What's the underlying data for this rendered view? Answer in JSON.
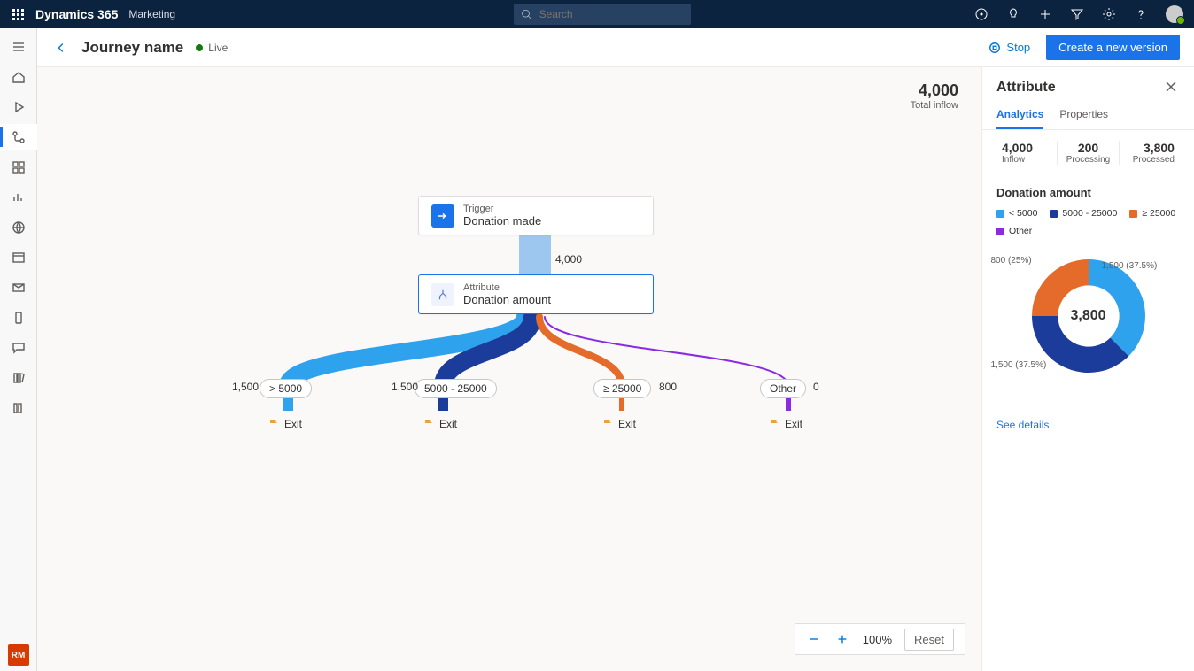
{
  "top": {
    "app": "Dynamics 365",
    "area": "Marketing",
    "search_placeholder": "Search"
  },
  "nav_badge": "RM",
  "header": {
    "title": "Journey name",
    "status": "Live",
    "stop": "Stop",
    "create_version": "Create a new version"
  },
  "totals": {
    "value": "4,000",
    "label": "Total inflow"
  },
  "flow": {
    "trigger": {
      "type": "Trigger",
      "name": "Donation made"
    },
    "trunk_count": "4,000",
    "attribute": {
      "type": "Attribute",
      "name": "Donation amount"
    },
    "branches": [
      {
        "label": "> 5000",
        "count": "1,500",
        "color": "#2EA2ED",
        "width": 20,
        "pillX": 263,
        "countX": 220
      },
      {
        "label": "5000 - 25000",
        "count": "1,500",
        "color": "#1C3C9C",
        "width": 20,
        "pillX": 438,
        "countX": 400
      },
      {
        "label": "≥ 25000",
        "count": "800",
        "color": "#E46B2A",
        "width": 8,
        "pillX": 640,
        "countX": 702
      },
      {
        "label": "Other",
        "count": "0",
        "color": "#8A2BE2",
        "width": 2,
        "pillX": 828,
        "countX": 876
      }
    ],
    "exit": "Exit"
  },
  "zoom": {
    "level": "100%",
    "reset": "Reset"
  },
  "panel": {
    "title": "Attribute",
    "tabs": [
      "Analytics",
      "Properties"
    ],
    "stats": [
      {
        "v": "4,000",
        "l": "Inflow"
      },
      {
        "v": "200",
        "l": "Processing"
      },
      {
        "v": "3,800",
        "l": "Processed"
      }
    ],
    "chart_title": "Donation amount",
    "see_details": "See details"
  },
  "chart_data": {
    "type": "pie",
    "title": "Donation amount",
    "center_value": "3,800",
    "series": [
      {
        "name": "< 5000",
        "value": 1500,
        "pct": 37.5,
        "label": "1,500 (37.5%)",
        "color": "#2EA2ED"
      },
      {
        "name": "5000 - 25000",
        "value": 1500,
        "pct": 37.5,
        "label": "1,500 (37.5%)",
        "color": "#1C3C9C"
      },
      {
        "name": "≥ 25000",
        "value": 800,
        "pct": 25.0,
        "label": "800 (25%)",
        "color": "#E46B2A"
      },
      {
        "name": "Other",
        "value": 0,
        "pct": 0.0,
        "label": "",
        "color": "#8A2BE2"
      }
    ]
  }
}
